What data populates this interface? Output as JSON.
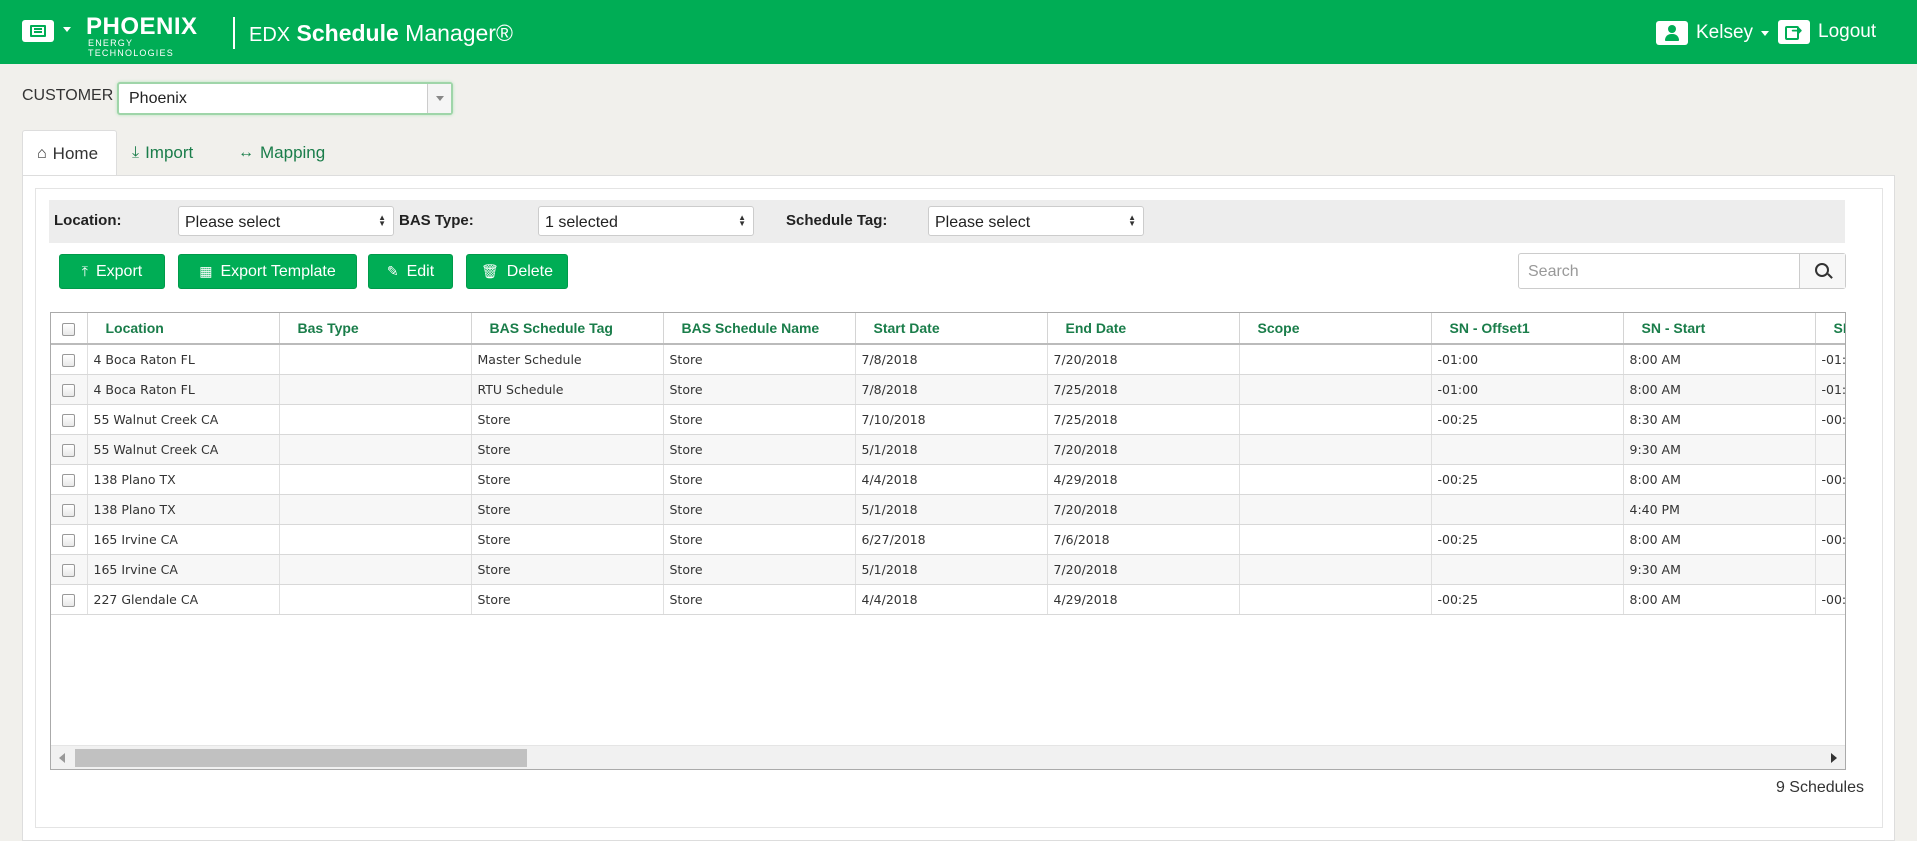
{
  "header": {
    "logo_main": "PHOENIX",
    "logo_sub": "ENERGY TECHNOLOGIES",
    "title_prefix": "EDX",
    "title_bold": "Schedule",
    "title_rest": "Manager®",
    "user_name": "Kelsey",
    "logout_label": "Logout",
    "bar_color": "#00ad55"
  },
  "customer": {
    "label": "CUSTOMER",
    "value": "Phoenix"
  },
  "tabs": [
    {
      "label": "Home",
      "icon": "home-icon",
      "active": true
    },
    {
      "label": "Import",
      "icon": "download-icon",
      "active": false
    },
    {
      "label": "Mapping",
      "icon": "arrows-horizontal-icon",
      "active": false
    }
  ],
  "filters": {
    "location_label": "Location:",
    "location_value": "Please select",
    "bas_type_label": "BAS Type:",
    "bas_type_value": "1 selected",
    "schedule_tag_label": "Schedule Tag:",
    "schedule_tag_value": "Please select"
  },
  "toolbar": {
    "export_label": "Export",
    "export_template_label": "Export Template",
    "edit_label": "Edit",
    "delete_label": "Delete",
    "search_placeholder": "Search"
  },
  "table": {
    "columns": [
      "Location",
      "Bas Type",
      "BAS Schedule Tag",
      "BAS Schedule Name",
      "Start Date",
      "End Date",
      "Scope",
      "SN - Offset1",
      "SN - Start",
      "SN"
    ],
    "rows": [
      [
        "4 Boca Raton FL",
        "",
        "Master Schedule",
        "Store",
        "7/8/2018",
        "7/20/2018",
        "",
        "-01:00",
        "8:00 AM",
        "-01:"
      ],
      [
        "4 Boca Raton FL",
        "",
        "RTU Schedule",
        "Store",
        "7/8/2018",
        "7/25/2018",
        "",
        "-01:00",
        "8:00 AM",
        "-01:"
      ],
      [
        "55 Walnut Creek CA",
        "",
        "Store",
        "Store",
        "7/10/2018",
        "7/25/2018",
        "",
        "-00:25",
        "8:30 AM",
        "-00:"
      ],
      [
        "55 Walnut Creek CA",
        "",
        "Store",
        "Store",
        "5/1/2018",
        "7/20/2018",
        "",
        "",
        "9:30 AM",
        ""
      ],
      [
        "138 Plano TX",
        "",
        "Store",
        "Store",
        "4/4/2018",
        "4/29/2018",
        "",
        "-00:25",
        "8:00 AM",
        "-00:"
      ],
      [
        "138 Plano TX",
        "",
        "Store",
        "Store",
        "5/1/2018",
        "7/20/2018",
        "",
        "",
        "4:40 PM",
        ""
      ],
      [
        "165 Irvine CA",
        "",
        "Store",
        "Store",
        "6/27/2018",
        "7/6/2018",
        "",
        "-00:25",
        "8:00 AM",
        "-00:"
      ],
      [
        "165 Irvine CA",
        "",
        "Store",
        "Store",
        "5/1/2018",
        "7/20/2018",
        "",
        "",
        "9:30 AM",
        ""
      ],
      [
        "227 Glendale CA",
        "",
        "Store",
        "Store",
        "4/4/2018",
        "4/29/2018",
        "",
        "-00:25",
        "8:00 AM",
        "-00:"
      ]
    ]
  },
  "footer": {
    "count_label": "9 Schedules"
  }
}
